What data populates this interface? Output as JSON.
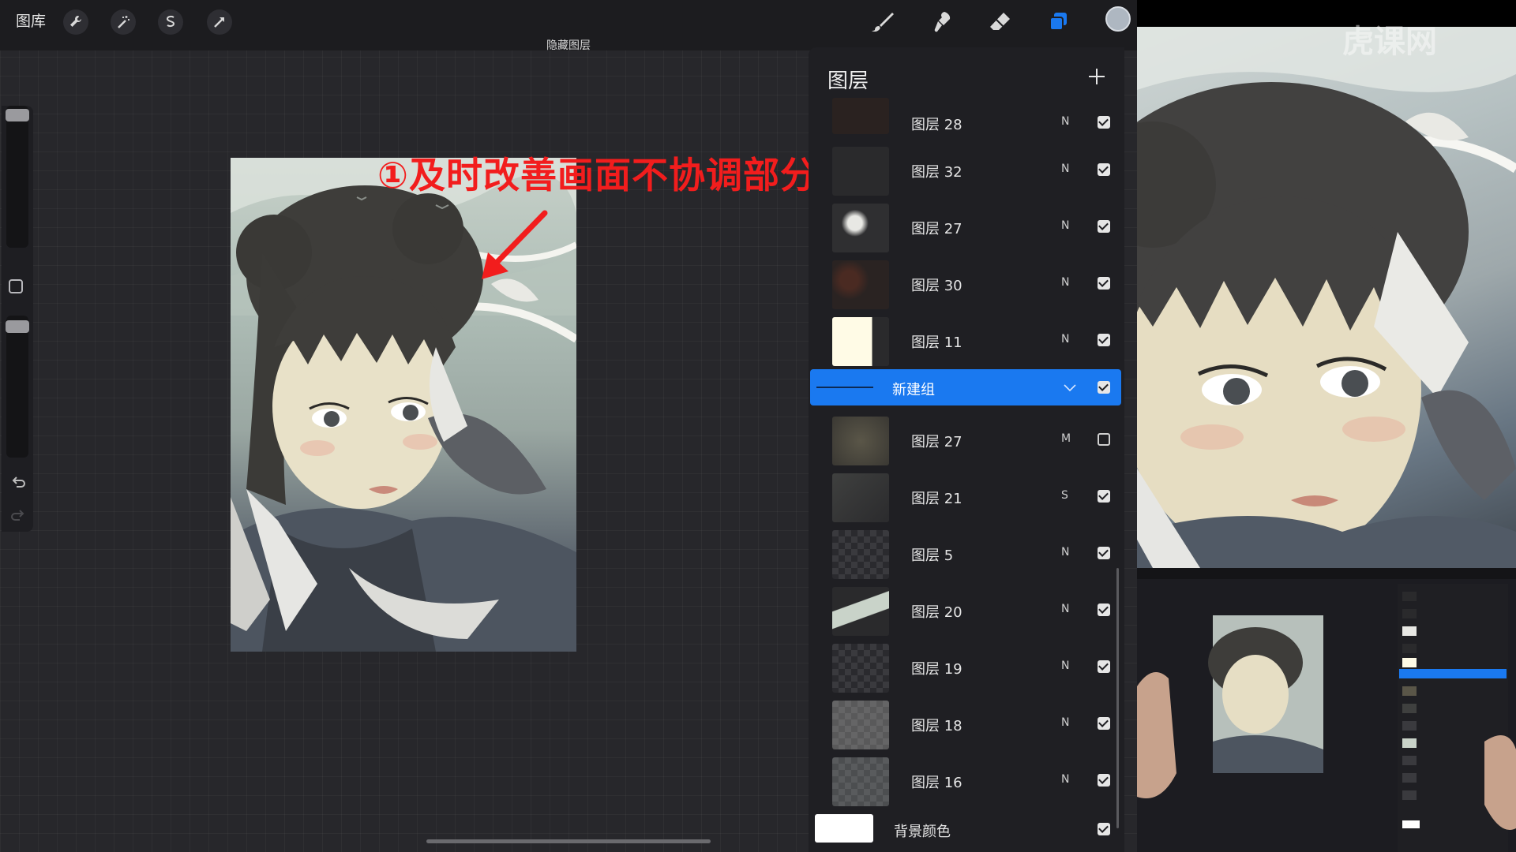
{
  "topbar": {
    "gallery_label": "图库",
    "hidden_layer_label": "隐藏图层",
    "tools": [
      "wrench-icon",
      "magic-wand-icon",
      "selection-icon",
      "transform-icon"
    ],
    "paint_tools": [
      "brush-icon",
      "smudge-icon",
      "eraser-icon",
      "layers-icon"
    ],
    "current_color": "#aeb7c1"
  },
  "annotation": {
    "text": "①及时改善画面不协调部分",
    "color": "#f21d1d"
  },
  "layers_panel": {
    "title": "图层",
    "layers_before_group": [
      {
        "name": "图层 28",
        "mode": "N",
        "visible": true
      },
      {
        "name": "图层 32",
        "mode": "N",
        "visible": true
      },
      {
        "name": "图层 27",
        "mode": "N",
        "visible": true
      },
      {
        "name": "图层 30",
        "mode": "N",
        "visible": true
      },
      {
        "name": "图层 11",
        "mode": "N",
        "visible": true
      }
    ],
    "group": {
      "name": "新建组",
      "visible": true,
      "accent": "#1a79f0"
    },
    "layers_after_group": [
      {
        "name": "图层 27",
        "mode": "M",
        "visible": false
      },
      {
        "name": "图层 21",
        "mode": "S",
        "visible": true
      },
      {
        "name": "图层 5",
        "mode": "N",
        "visible": true
      },
      {
        "name": "图层 20",
        "mode": "N",
        "visible": true
      },
      {
        "name": "图层 19",
        "mode": "N",
        "visible": true
      },
      {
        "name": "图层 18",
        "mode": "N",
        "visible": true
      },
      {
        "name": "图层 16",
        "mode": "N",
        "visible": true
      }
    ],
    "background": {
      "name": "背景颜色",
      "visible": true
    }
  },
  "watermark": "虎课网"
}
